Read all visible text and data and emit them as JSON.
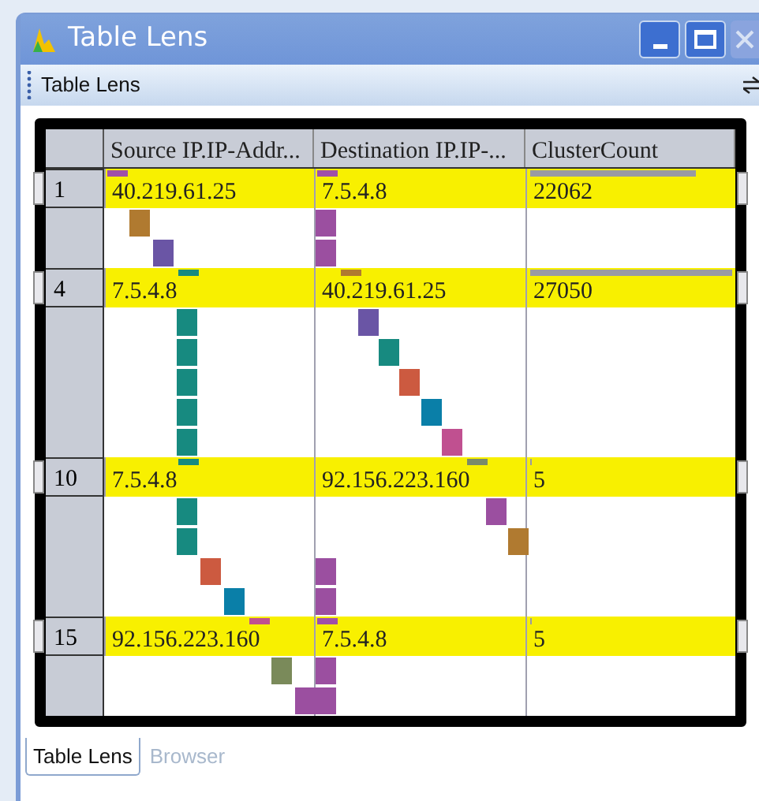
{
  "window": {
    "title": "Table Lens"
  },
  "toolbar": {
    "title": "Table Lens"
  },
  "table": {
    "columns": [
      "Source IP.IP-Addr...",
      "Destination IP.IP-...",
      "ClusterCount"
    ],
    "rows": [
      {
        "index": "1",
        "cells": [
          {
            "kind": "category",
            "text": "40.219.61.25",
            "color": "#a050a8"
          },
          {
            "kind": "category",
            "text": "7.5.4.8",
            "color": "#a050a8"
          },
          {
            "kind": "count",
            "text": "22062",
            "level": 0.82
          }
        ]
      },
      {
        "index": "4",
        "cells": [
          {
            "kind": "category",
            "text": "7.5.4.8",
            "color": "#178a80"
          },
          {
            "kind": "category",
            "text": "40.219.61.25",
            "color": "#b07a30"
          },
          {
            "kind": "count",
            "text": "27050",
            "level": 1
          }
        ]
      },
      {
        "index": "10",
        "cells": [
          {
            "kind": "category",
            "text": "7.5.4.8",
            "color": "#178a80"
          },
          {
            "kind": "category",
            "text": "92.156.223.160",
            "color": "#7a8a6a"
          },
          {
            "kind": "count",
            "text": "5",
            "level": 0.01
          }
        ]
      },
      {
        "index": "15",
        "cells": [
          {
            "kind": "category",
            "text": "92.156.223.160",
            "color": "#c05090"
          },
          {
            "kind": "category",
            "text": "7.5.4.8",
            "color": "#a050a8"
          },
          {
            "kind": "count",
            "text": "5",
            "level": 0.01
          }
        ]
      }
    ]
  },
  "tabs": [
    {
      "label": "Table Lens",
      "selected": true
    },
    {
      "label": "Browser",
      "selected": false
    }
  ]
}
